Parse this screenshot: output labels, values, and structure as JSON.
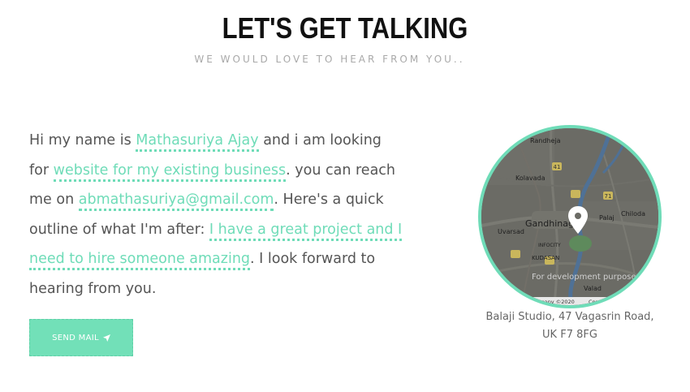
{
  "header": {
    "title": "LET'S GET TALKING",
    "subtitle": "WE WOULD LOVE TO HEAR FROM YOU.."
  },
  "form": {
    "text_1": "Hi my name is ",
    "name_value": "Mathasuriya Ajay",
    "text_2": " and i am looking for ",
    "project_value": "website for my existing business",
    "text_3": ". you can reach me on ",
    "email_value": "abmathasuriya@gmail.com",
    "text_4": ". Here's a quick outline of what I'm after: ",
    "details_value": "I have a great project and I need to hire someone amazing",
    "text_5": ". I look forward to hearing from you.",
    "send_label": "SEND MAIL"
  },
  "map": {
    "labels": {
      "randheja": "Randheja",
      "kolavada": "Kolavada",
      "gandhinagar": "Gandhinag",
      "uvarsad": "Uvarsad",
      "palaj": "Palaj",
      "chiloda": "Chiloda",
      "infocity": "INFOCITY",
      "kudasan": "KUDASAN",
      "valad": "Valad",
      "dev_notice": "For development purposes",
      "attribution": "Dane do mapy ©2020",
      "attribution_2": "Condi",
      "route_41": "41",
      "route_71": "71"
    },
    "pin_color": "#ffffff",
    "ring_color": "#6fdcb8"
  },
  "address": {
    "line1": "Balaji Studio, 47 Vagasrin Road,",
    "line2": "UK F7 8FG"
  }
}
